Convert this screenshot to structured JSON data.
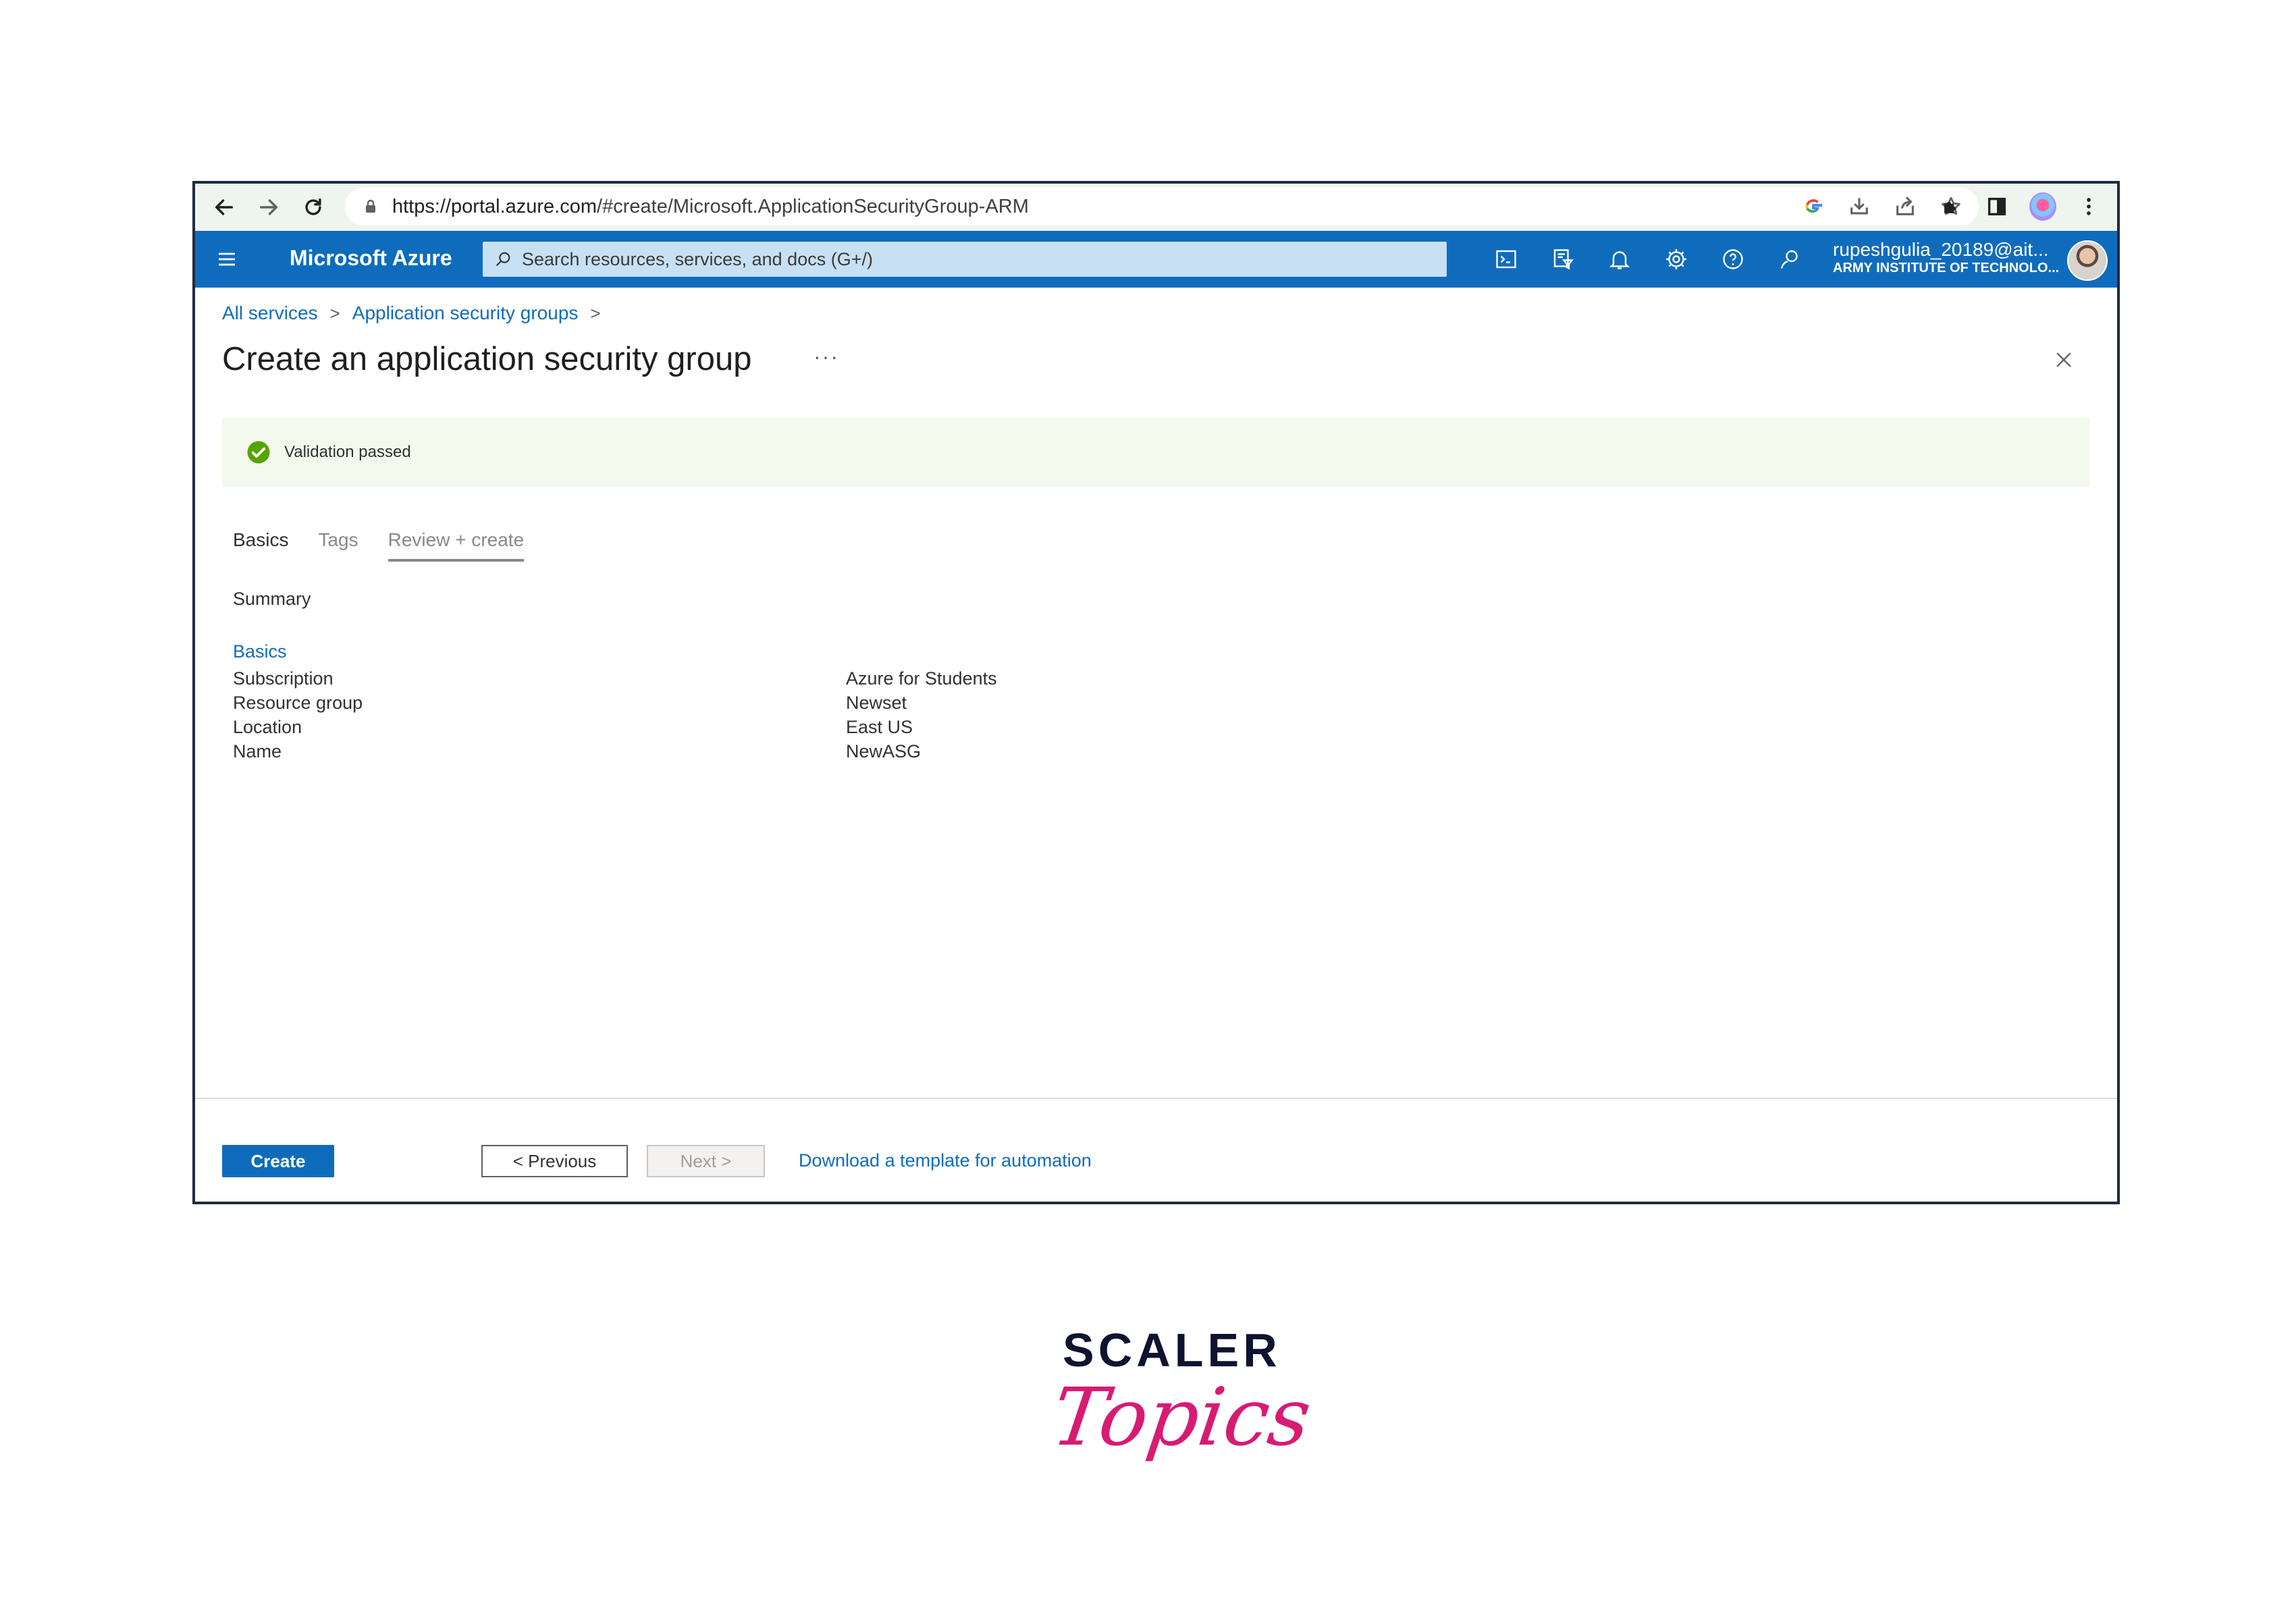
{
  "browser": {
    "url_host": "https://portal.azure.com",
    "url_path": "/#create/Microsoft.ApplicationSecurityGroup-ARM"
  },
  "azure": {
    "brand": "Microsoft Azure",
    "search_placeholder": "Search resources, services, and docs (G+/)",
    "account_name": "rupeshgulia_20189@ait...",
    "account_org": "ARMY INSTITUTE OF TECHNOLO..."
  },
  "breadcrumb": {
    "items": [
      "All services",
      "Application security groups"
    ],
    "separator": ">"
  },
  "page": {
    "title": "Create an application security group",
    "more": "···",
    "validation_message": "Validation passed"
  },
  "tabs": [
    "Basics",
    "Tags",
    "Review + create"
  ],
  "summary": {
    "heading": "Summary",
    "section": "Basics",
    "rows": [
      {
        "label": "Subscription",
        "value": "Azure for Students"
      },
      {
        "label": "Resource group",
        "value": "Newset"
      },
      {
        "label": "Location",
        "value": "East US"
      },
      {
        "label": "Name",
        "value": "NewASG"
      }
    ]
  },
  "footer": {
    "create": "Create",
    "previous": "< Previous",
    "next": "Next >",
    "download_link": "Download a template for automation"
  },
  "logo": {
    "line1": "SCALER",
    "line2": "Topics"
  },
  "colors": {
    "azure_blue": "#0f6cbd",
    "success_green": "#57a300",
    "banner_bg": "#f3f9ec",
    "logo_pink": "#d81b72",
    "logo_navy": "#0e1330"
  }
}
